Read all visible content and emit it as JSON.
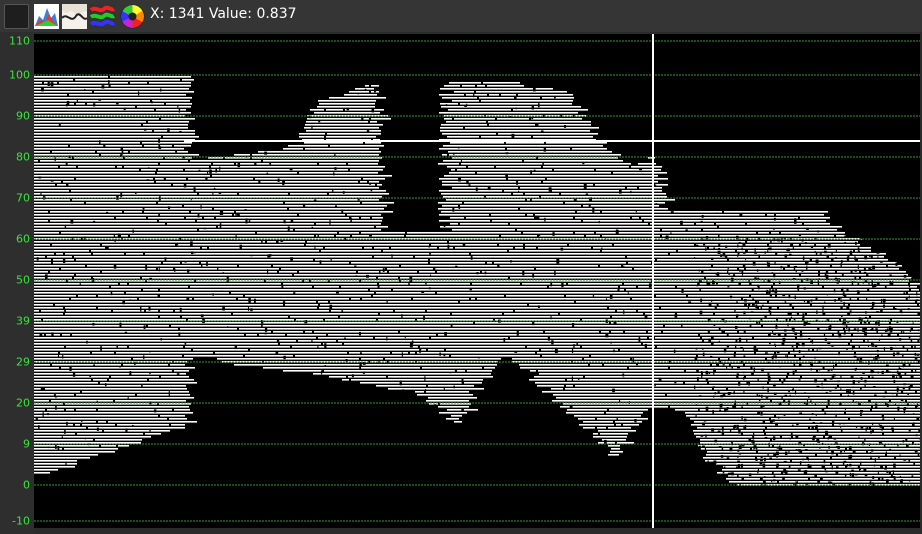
{
  "toolbar": {
    "buttons": [
      {
        "name": "color-box-button",
        "icon": "dark-square-icon"
      },
      {
        "name": "spectrum-button",
        "icon": "spectrum-icon"
      },
      {
        "name": "waveform-button",
        "icon": "waveform-icon"
      },
      {
        "name": "bands-button",
        "icon": "color-bands-icon"
      },
      {
        "name": "color-wheel-button",
        "icon": "color-wheel-icon"
      }
    ],
    "readout": "X: 1341  Value: 0.837"
  },
  "y_axis": {
    "ticks": [
      "110",
      "100",
      "90",
      "80",
      "70",
      "60",
      "50",
      "39",
      "29",
      "20",
      "9",
      "0",
      "-10"
    ],
    "tick_color": "#39e639"
  },
  "plot": {
    "background": "#000000",
    "signal_color": "#ffffff",
    "grid_color": "#2f9a2f",
    "cursor_level": 0.837
  }
}
